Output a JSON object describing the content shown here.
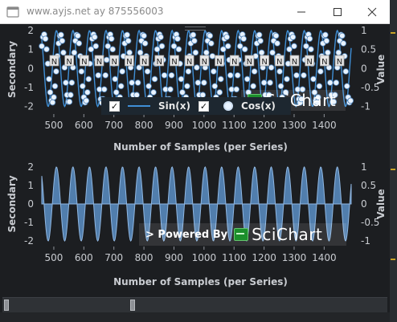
{
  "window": {
    "title": "www.ayjs.net ay 875556003",
    "controls": {
      "minimize": "minimize",
      "maximize": "maximize",
      "close": "close"
    }
  },
  "colors": {
    "background": "#1c1e21",
    "sine": "#3f8fd6",
    "sine_fill": "#5a8fc5",
    "cos_marker": "#e9f3ff",
    "label": "#c9ccd1"
  },
  "top_chart": {
    "legend": [
      {
        "label": "Sin(x)",
        "checked": true,
        "marker": "line"
      },
      {
        "label": "Cos(x)",
        "checked": true,
        "marker": "ellipse"
      }
    ],
    "annotation_text": "N",
    "watermark": "SciChart"
  },
  "bottom_chart": {
    "watermark_powered": "> Powered By",
    "watermark_brand": "SciChart"
  },
  "chart_data": [
    {
      "type": "line",
      "xlabel": "Number of Samples (per Series)",
      "ylabel_left": "Secondary",
      "ylabel_right": "Value",
      "xlim": [
        460,
        1490
      ],
      "x_ticks": [
        500,
        600,
        700,
        800,
        900,
        1000,
        1100,
        1200,
        1300,
        1400
      ],
      "left_ticks": [
        -2,
        -1,
        0,
        1,
        2
      ],
      "left_ylim": [
        -2.4,
        2.3
      ],
      "right_ticks": [
        -1,
        -0.5,
        0,
        0.5,
        1
      ],
      "right_ylim": [
        -1.2,
        1.15
      ],
      "series": [
        {
          "name": "Sin(x)",
          "axis": "left",
          "amplitude": 2,
          "period": 55,
          "phase": 0,
          "style": "line"
        },
        {
          "name": "Cos(x)",
          "axis": "right",
          "amplitude": 0.9,
          "period": 55,
          "phase": 13.75,
          "style": "scatter"
        }
      ],
      "annotations_x": [
        500,
        550,
        600,
        650,
        700,
        750,
        800,
        850,
        900,
        950,
        1000,
        1050,
        1100,
        1150,
        1200,
        1250,
        1300,
        1350,
        1400,
        1450
      ]
    },
    {
      "type": "area",
      "xlabel": "Number of Samples (per Series)",
      "ylabel_left": "Secondary",
      "ylabel_right": "Value",
      "xlim": [
        460,
        1490
      ],
      "x_ticks": [
        500,
        600,
        700,
        800,
        900,
        1000,
        1100,
        1200,
        1300,
        1400
      ],
      "left_ticks": [
        -2,
        -1,
        0,
        1,
        2
      ],
      "left_ylim": [
        -2.3,
        2.3
      ],
      "right_ticks": [
        -1,
        -0.5,
        0,
        0.5,
        1
      ],
      "right_ylim": [
        -1.15,
        1.15
      ],
      "series": [
        {
          "name": "Sin(x)",
          "axis": "left",
          "amplitude": 2,
          "period": 55,
          "phase": 0,
          "style": "mountain"
        }
      ]
    }
  ]
}
